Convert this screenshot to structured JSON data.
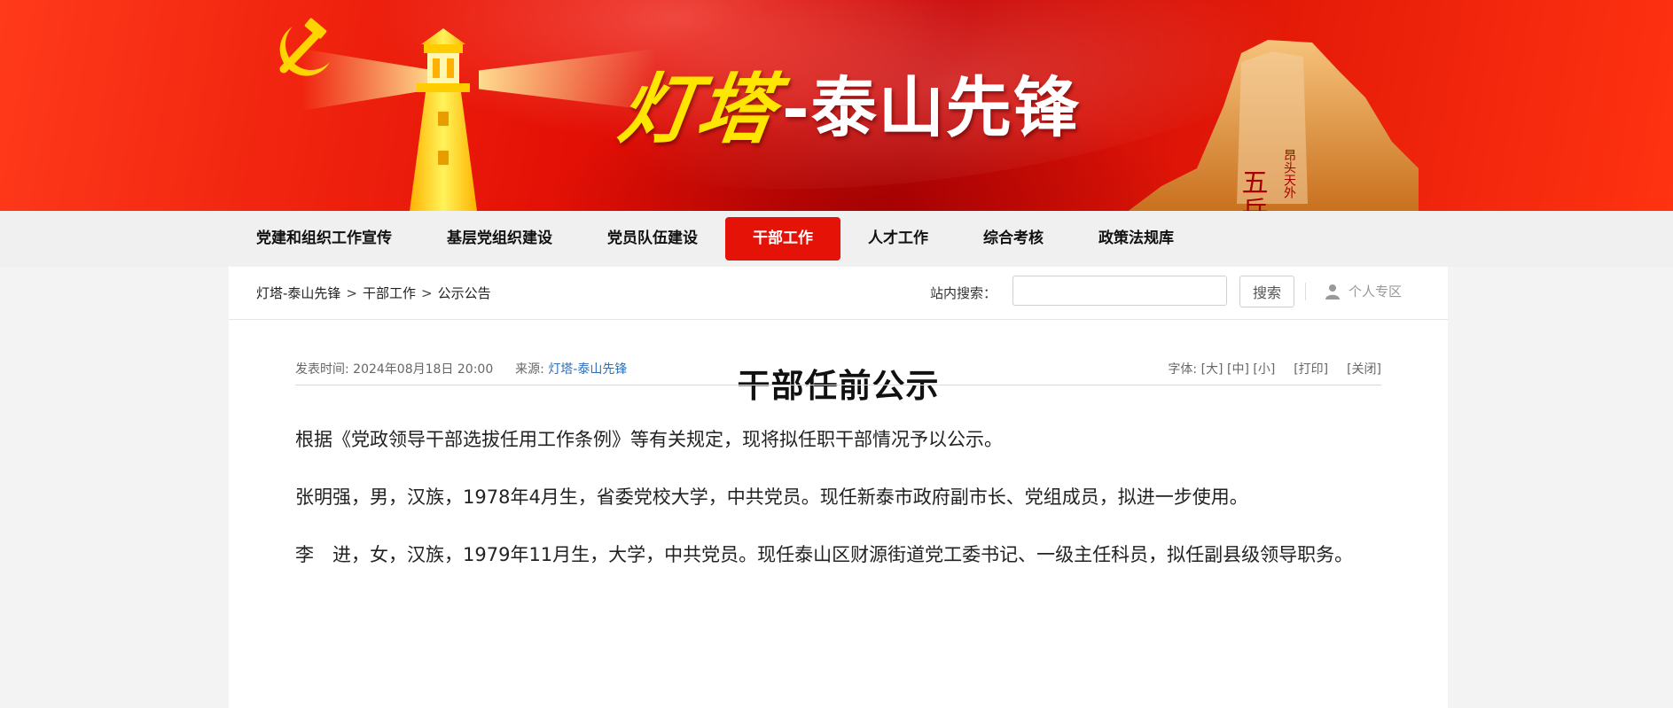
{
  "banner": {
    "title_part1": "灯塔",
    "title_part2": "-泰山先锋",
    "rock_text_main": "五岳独尊",
    "rock_text_side": "昂头天外"
  },
  "nav": {
    "items": [
      {
        "label": "党建和组织工作宣传",
        "active": false
      },
      {
        "label": "基层党组织建设",
        "active": false
      },
      {
        "label": "党员队伍建设",
        "active": false
      },
      {
        "label": "干部工作",
        "active": true
      },
      {
        "label": "人才工作",
        "active": false
      },
      {
        "label": "综合考核",
        "active": false
      },
      {
        "label": "政策法规库",
        "active": false
      }
    ]
  },
  "breadcrumb": {
    "items": [
      "灯塔-泰山先锋",
      "干部工作",
      "公示公告"
    ],
    "separator": ">"
  },
  "search": {
    "label": "站内搜索：",
    "value": "",
    "placeholder": "",
    "button_label": "搜索"
  },
  "personal": {
    "label": "个人专区",
    "icon": "user-icon"
  },
  "article": {
    "title": "干部任前公示",
    "publish_label": "发表时间:",
    "publish_time": "2024年08月18日 20:00",
    "source_label": "来源:",
    "source": "灯塔-泰山先锋",
    "font_label": "字体:",
    "font_large": "[大]",
    "font_medium": "[中]",
    "font_small": "[小]",
    "print": "[打印]",
    "close": "[关闭]",
    "paragraphs": [
      "根据《党政领导干部选拔任用工作条例》等有关规定，现将拟任职干部情况予以公示。",
      "张明强，男，汉族，1978年4月生，省委党校大学，中共党员。现任新泰市政府副市长、党组成员，拟进一步使用。",
      "李　进，女，汉族，1979年11月生，大学，中共党员。现任泰山区财源街道党工委书记、一级主任科员，拟任副县级领导职务。"
    ]
  },
  "colors": {
    "nav_active": "#e41207",
    "banner_red": "#d80a05",
    "source_link": "#2c6fb8"
  }
}
